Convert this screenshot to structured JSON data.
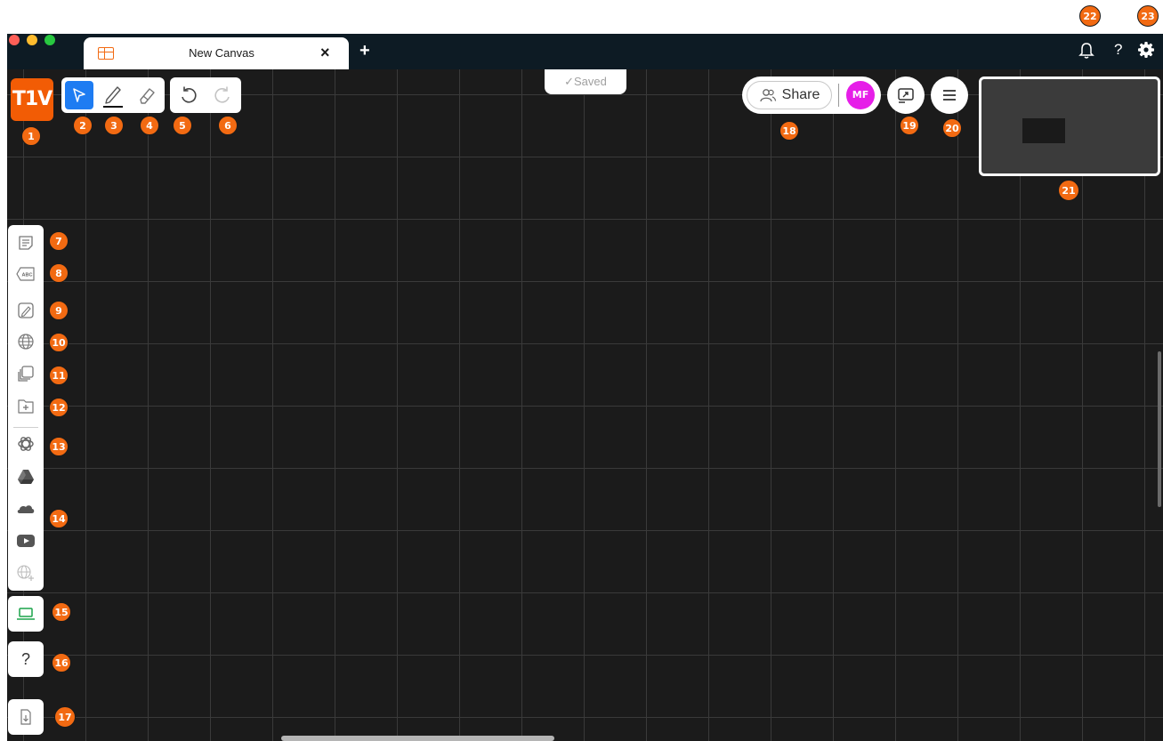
{
  "window": {
    "tab_title": "New Canvas",
    "tab_close": "×",
    "new_tab": "+",
    "help": "?"
  },
  "header": {
    "logo": "T1V",
    "saved_status": "✓Saved",
    "share_label": "Share",
    "avatar_initials": "MF"
  },
  "toolbar": {
    "tools": [
      "select",
      "pen",
      "eraser",
      "undo",
      "redo"
    ],
    "active_tool": "select"
  },
  "sidebar": {
    "items": [
      {
        "name": "sticky-note",
        "icon": "note-icon"
      },
      {
        "name": "text",
        "icon": "abc-text-icon",
        "label": "ABC"
      },
      {
        "name": "sketch",
        "icon": "sketch-icon"
      },
      {
        "name": "browser",
        "icon": "globe-icon"
      },
      {
        "name": "templates",
        "icon": "stack-icon"
      },
      {
        "name": "add-file",
        "icon": "folder-plus-icon"
      },
      {
        "name": "ai",
        "icon": "openai-icon"
      },
      {
        "name": "google-drive",
        "icon": "drive-icon"
      },
      {
        "name": "onedrive",
        "icon": "cloud-icon"
      },
      {
        "name": "youtube",
        "icon": "youtube-icon"
      },
      {
        "name": "add-website",
        "icon": "globe-add-icon"
      }
    ],
    "help_label": "?"
  },
  "badges": [
    "1",
    "2",
    "3",
    "4",
    "5",
    "6",
    "7",
    "8",
    "9",
    "10",
    "11",
    "12",
    "13",
    "14",
    "15",
    "16",
    "17",
    "18",
    "19",
    "20",
    "21",
    "22",
    "23"
  ],
  "colors": {
    "accent": "#f26a12",
    "logo": "#f25c05",
    "active_tool": "#1e7cf2",
    "avatar": "#e61ee8",
    "titlebar": "#0d1b24",
    "canvas": "#1b1b1b",
    "screen_share": "#1aa34a"
  }
}
